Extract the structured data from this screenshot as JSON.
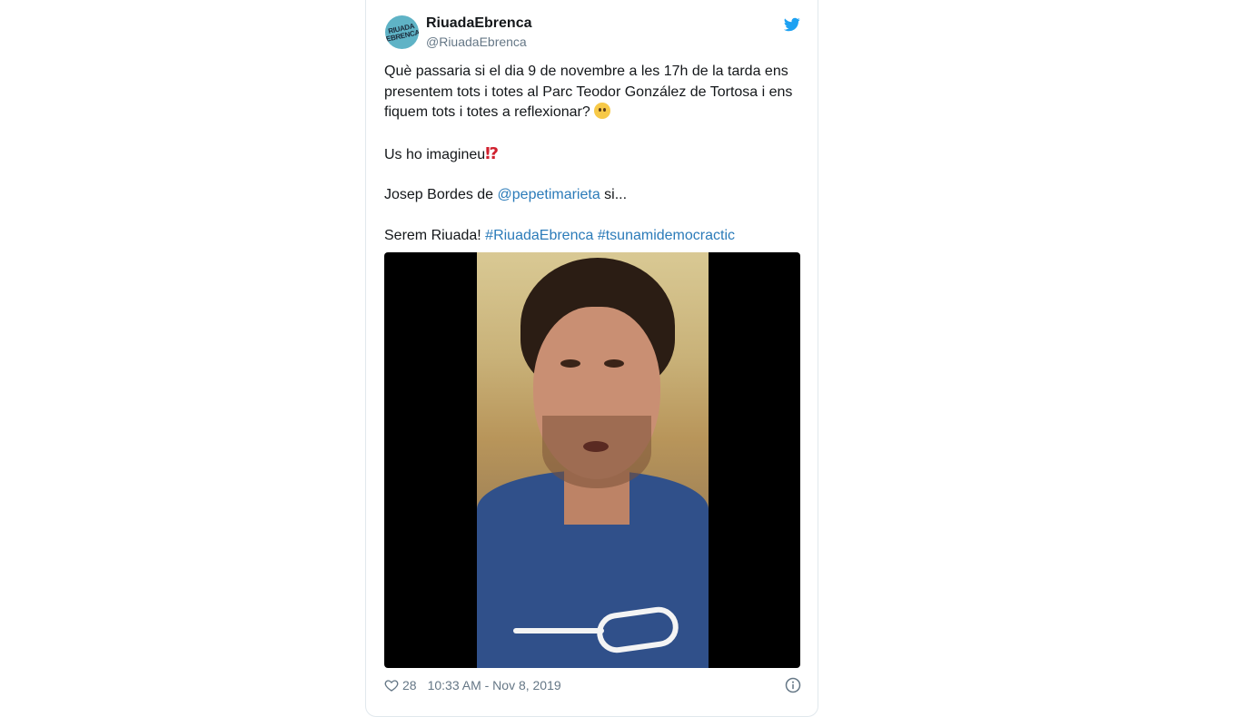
{
  "author": {
    "name": "RiuadaEbrenca",
    "handle": "@RiuadaEbrenca",
    "avatar_text": "RIUADA EBRENCA"
  },
  "tweet": {
    "line1": "Què passaria si el dia 9 de novembre a les 17h de la tarda ens presentem tots i totes al Parc Teodor González de Tortosa i ens fiquem tots i totes a reflexionar?",
    "line2": "Us ho imagineu",
    "interrobang": "⁉",
    "line3_prefix": "Josep Bordes de",
    "mention": "@pepetimarieta",
    "line3_suffix": "si...",
    "line4_prefix": "Serem Riuada!",
    "hashtags": [
      "#RiuadaEbrenca",
      "#tsunamidemocractic"
    ]
  },
  "footer": {
    "likes": "28",
    "timestamp": "10:33 AM - Nov 8, 2019"
  },
  "colors": {
    "link": "#2b7bb9",
    "twitter_blue": "#1da1f2",
    "muted": "#657786"
  },
  "icons": [
    "twitter-bird-icon",
    "thinking-face-emoji",
    "interrobang-emoji",
    "heart-icon",
    "info-icon"
  ]
}
